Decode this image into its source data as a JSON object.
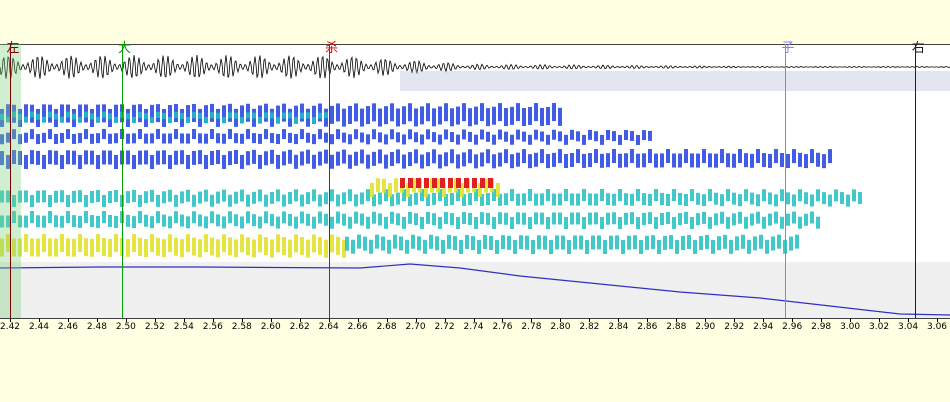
{
  "markers": [
    {
      "label": "左",
      "time": 2.42,
      "color": "#800000"
    },
    {
      "label": "大",
      "time": 2.497,
      "color": "#00a000"
    },
    {
      "label": "杀",
      "time": 2.64,
      "color": "#e00000"
    },
    {
      "label": "子",
      "time": 2.955,
      "color": "#8080ff"
    },
    {
      "label": "右",
      "time": 3.045,
      "color": "#202020"
    }
  ],
  "time_axis": {
    "start": 2.42,
    "end": 3.06,
    "step": 0.02,
    "ticks": [
      "2.42",
      "2.44",
      "2.46",
      "2.48",
      "2.50",
      "2.52",
      "2.54",
      "2.56",
      "2.58",
      "2.60",
      "2.62",
      "2.64",
      "2.66",
      "2.68",
      "2.70",
      "2.72",
      "2.74",
      "2.76",
      "2.78",
      "2.80",
      "2.82",
      "2.84",
      "2.86",
      "2.88",
      "2.90",
      "2.92",
      "2.94",
      "2.96",
      "2.98",
      "3.00",
      "3.02",
      "3.04",
      "3.06"
    ]
  },
  "colors": {
    "background": "#ffffe1",
    "selection": "#c8f0c8",
    "pitch_line": "#3030c0",
    "spectro_low": "#2040e0",
    "spectro_mid": "#20c0c0",
    "spectro_high": "#e0e020",
    "spectro_peak": "#e02020"
  }
}
